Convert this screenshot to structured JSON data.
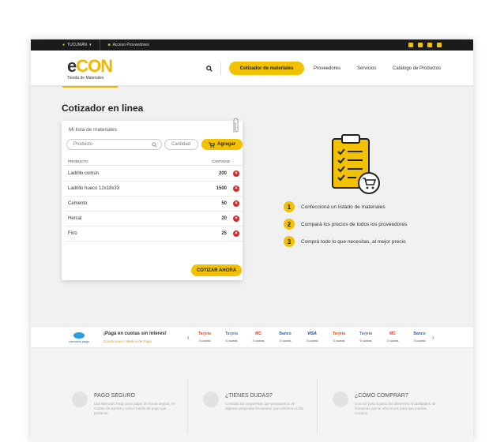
{
  "topbar": {
    "city": "TUCUMÁN",
    "access": "Acceso Proveedores",
    "socials": [
      "facebook-icon",
      "twitter-icon",
      "instagram-icon",
      "youtube-icon"
    ]
  },
  "header": {
    "logo_e": "e",
    "logo_con": "CON",
    "logo_tagline": "Tienda de Materiales",
    "cta": "Cotizador de materiales",
    "nav": [
      "Proveedores",
      "Servicios",
      "Catálogo de Productos"
    ]
  },
  "main": {
    "title": "Cotizador en linea",
    "card": {
      "title": "Mi lista de materiales",
      "product_placeholder": "Producto",
      "qty_placeholder": "Cantidad",
      "add_label": "Agregar",
      "col_product": "PRODUCTO",
      "col_qty": "CANTIDAD",
      "rows": [
        {
          "name": "Ladrillo común",
          "qty": "200"
        },
        {
          "name": "Ladrillo hueco 12x18x33",
          "qty": "1500"
        },
        {
          "name": "Cemento",
          "qty": "50"
        },
        {
          "name": "Hercal",
          "qty": "20"
        },
        {
          "name": "Fino",
          "qty": "25"
        }
      ],
      "submit_label": "COTIZAR AHORA"
    },
    "steps": [
      {
        "num": "1",
        "text": "Confeccioná un listado de materiales"
      },
      {
        "num": "2",
        "text": "Comparà los precios de todos los proveedores"
      },
      {
        "num": "3",
        "text": "Comprá todo lo que necesitas, al mejor precio"
      }
    ]
  },
  "payments": {
    "logo_text": "mercado pago",
    "title": "¡Pagá en cuotas sin interes!",
    "links": "Condiciones | Medios de Pago",
    "items": [
      {
        "logo": "Tarjeta",
        "color": "#e8541f",
        "cuotas": "3 cuotas"
      },
      {
        "logo": "Tarjeta",
        "color": "#5b7fb4",
        "cuotas": "6 cuotas"
      },
      {
        "logo": "MC",
        "color": "#e13b2d",
        "cuotas": "3 cuotas"
      },
      {
        "logo": "Banco",
        "color": "#2a62b3",
        "cuotas": "3 cuotas"
      },
      {
        "logo": "VISA",
        "color": "#1a3c95",
        "cuotas": "3 cuotas"
      },
      {
        "logo": "Tarjeta",
        "color": "#e8541f",
        "cuotas": "3 cuotas"
      },
      {
        "logo": "Tarjeta",
        "color": "#5b7fb4",
        "cuotas": "6 cuotas"
      },
      {
        "logo": "MC",
        "color": "#e13b2d",
        "cuotas": "3 cuotas"
      },
      {
        "logo": "Banco",
        "color": "#2a62b3",
        "cuotas": "3 cuotas"
      }
    ]
  },
  "footer": {
    "cols": [
      {
        "title": "PAGO SEGURO",
        "desc": "Usa Mercado Pago para pagar de forma segura, en cuotas sin interés y con el medio de pago que prefieras."
      },
      {
        "title": "¿TIENES DUDAS?",
        "desc": "Consulta las respuestas que preparamos de algunas preguntas frecuentes que solemos recibir."
      },
      {
        "title": "¿CÓMO COMPRAR?",
        "desc": "Conocé paso a paso las diferentes modalidades de búsqueda que te ofrecemos para que puedas comprar."
      }
    ]
  },
  "colors": {
    "accent": "#f2c200",
    "danger": "#d32b2b",
    "dark": "#1b1b1b"
  }
}
